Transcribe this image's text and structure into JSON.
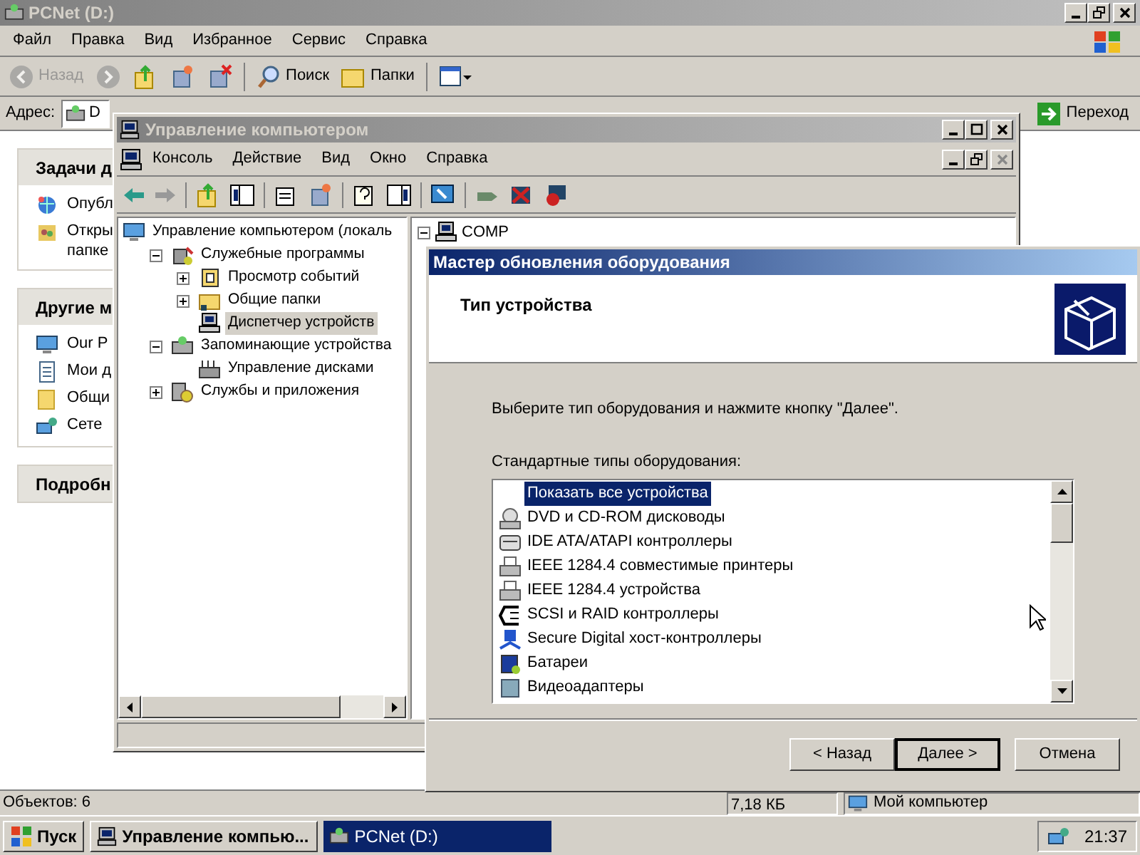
{
  "explorer": {
    "title": "PCNet (D:)",
    "menu": [
      "Файл",
      "Правка",
      "Вид",
      "Избранное",
      "Сервис",
      "Справка"
    ],
    "toolbar": [
      {
        "kind": "back",
        "label": "Назад",
        "disabled": true
      },
      {
        "kind": "forward",
        "disabled": true
      },
      {
        "kind": "up",
        "disabled": false
      },
      {
        "kind": "move",
        "disabled": false
      },
      {
        "kind": "delete",
        "disabled": false
      },
      {
        "kind": "search",
        "label": "Поиск",
        "disabled": false
      },
      {
        "kind": "folders",
        "label": "Папки",
        "disabled": false
      },
      {
        "kind": "views",
        "disabled": false
      }
    ],
    "address": {
      "label": "Адрес:",
      "value": "D"
    },
    "go_button": "Переход",
    "task_panels": [
      {
        "title": "Задачи д",
        "items": [
          {
            "kind": "publish",
            "label": "Опубл"
          },
          {
            "kind": "share",
            "label": "Откры",
            "line_2": "папке"
          }
        ]
      },
      {
        "title": "Другие м",
        "items": [
          {
            "kind": "computer",
            "label": "Our P"
          },
          {
            "kind": "documents",
            "label": "Мои д"
          },
          {
            "kind": "folder",
            "label": "Общи"
          },
          {
            "kind": "network",
            "label": "Сете"
          }
        ]
      },
      {
        "title": "Подробн"
      }
    ],
    "status_bar": [
      "Объектов: 6",
      "7,18 КБ",
      "Мой компьютер"
    ]
  },
  "mmc": {
    "title": "Управление компьютером",
    "menu": [
      "Консоль",
      "Действие",
      "Вид",
      "Окно",
      "Справка"
    ],
    "tree": [
      {
        "kind": "computer",
        "label": "Управление компьютером (локаль",
        "selected": false,
        "children": [
          {
            "kind": "tools",
            "label": "Служебные программы",
            "selected": false,
            "expanded": true,
            "children": [
              {
                "kind": "events",
                "label": "Просмотр событий",
                "selected": false,
                "expanded": false
              },
              {
                "kind": "shared",
                "label": "Общие папки",
                "selected": false,
                "expanded": false
              },
              {
                "kind": "devices",
                "label": "Диспетчер устройств",
                "selected": true
              }
            ]
          },
          {
            "kind": "storage",
            "label": "Запоминающие устройства",
            "selected": false,
            "expanded": true,
            "children": [
              {
                "kind": "disks",
                "label": "Управление дисками",
                "selected": false
              }
            ]
          },
          {
            "kind": "services",
            "label": "Службы и приложения",
            "selected": false,
            "expanded": false
          }
        ]
      }
    ],
    "right_tree": [
      {
        "label": "COMP",
        "expanded": true
      }
    ]
  },
  "wizard": {
    "title": "Мастер обновления оборудования",
    "heading": "Тип устройства",
    "instruction": "Выберите тип оборудования и нажмите кнопку \"Далее\".",
    "list_label": "Стандартные типы оборудования:",
    "devices": [
      {
        "kind": "all",
        "label": "Показать все устройства",
        "selected": true
      },
      {
        "kind": "drive",
        "label": "DVD и CD-ROM дисководы",
        "selected": false
      },
      {
        "kind": "controller",
        "label": "IDE ATA/ATAPI контроллеры",
        "selected": false
      },
      {
        "kind": "printer",
        "label": "IEEE 1284.4 совместимые принтеры",
        "selected": false
      },
      {
        "kind": "printer",
        "label": "IEEE 1284.4 устройства",
        "selected": false
      },
      {
        "kind": "scsi",
        "label": "SCSI и RAID контроллеры",
        "selected": false
      },
      {
        "kind": "sd",
        "label": "Secure Digital хост-контроллеры",
        "selected": false
      },
      {
        "kind": "battery",
        "label": "Батареи",
        "selected": false
      },
      {
        "kind": "display",
        "label": "Видеоадаптеры",
        "selected": false
      }
    ],
    "buttons": [
      {
        "label": "< Назад",
        "default": false
      },
      {
        "label": "Далее >",
        "default": true
      },
      {
        "label": "Отмена",
        "default": false
      }
    ]
  },
  "taskbar": {
    "start": "Пуск",
    "tasks": [
      {
        "label": "Управление компью...",
        "selected": false
      },
      {
        "label": "PCNet (D:)",
        "selected": true
      }
    ],
    "clock": "21:37"
  }
}
